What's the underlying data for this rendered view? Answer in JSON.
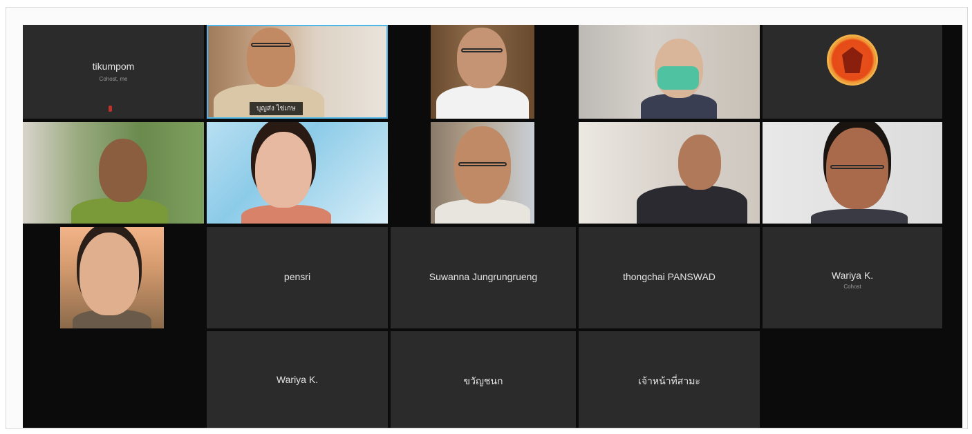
{
  "meeting": {
    "participants": [
      {
        "name": "tikumpom",
        "sub": "Cohost, me",
        "video": false
      },
      {
        "name": "",
        "caption": "บุญส่ง ไข่เกษ",
        "video": true,
        "active_speaker": true
      },
      {
        "name": "",
        "video": true
      },
      {
        "name": "",
        "video": true
      },
      {
        "name": "",
        "video": true,
        "emblem": "parliament-emblem"
      },
      {
        "name": "",
        "video": true
      },
      {
        "name": "",
        "video": true
      },
      {
        "name": "",
        "video": true
      },
      {
        "name": "",
        "video": true
      },
      {
        "name": "",
        "video": true
      },
      {
        "name": "",
        "video": true
      },
      {
        "name": "pensri",
        "video": false
      },
      {
        "name": "Suwanna Jungrungrueng",
        "video": false
      },
      {
        "name": "thongchai PANSWAD",
        "video": false
      },
      {
        "name": "Wariya K.",
        "sub": "Cohost",
        "video": false
      },
      {
        "name": "Wariya K.",
        "video": false
      },
      {
        "name": "ขวัญชนก",
        "video": false
      },
      {
        "name": "เจ้าหน้าที่สามะ",
        "video": false
      }
    ]
  },
  "colors": {
    "tile_bg": "#2b2b2b",
    "grid_bg": "#0b0b0b",
    "active_speaker": "#4fb7e8",
    "muted_mic": "#c0302a"
  },
  "icons": {
    "muted_mic": "muted-microphone-icon",
    "emblem": "parliament-emblem-icon"
  }
}
